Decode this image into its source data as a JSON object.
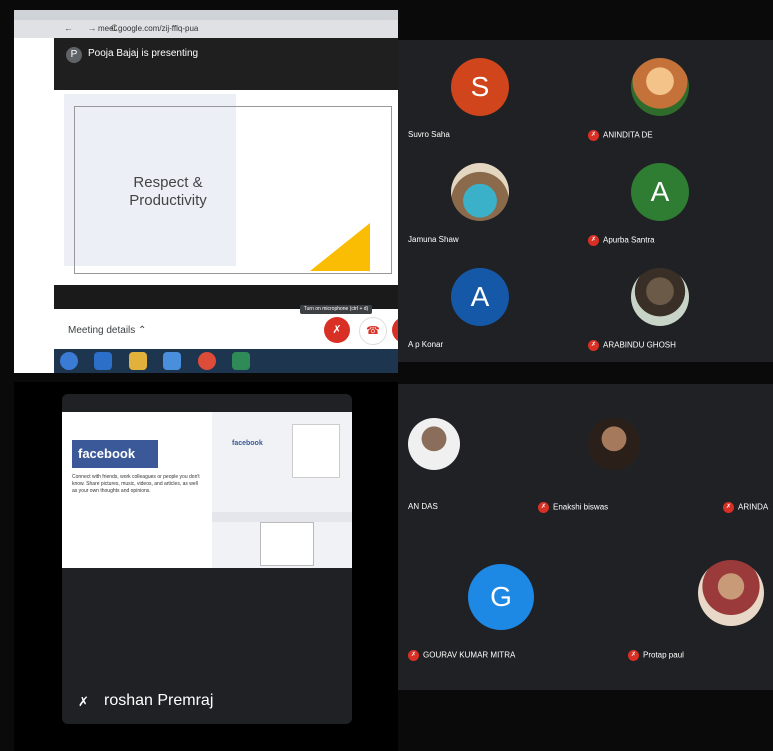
{
  "presentation": {
    "url": "meet.google.com/zij-fflq-pua",
    "presenter_initial": "P",
    "presenter_text": "Pooja Bajaj is presenting",
    "slide_title_line1": "Respect &",
    "slide_title_line2": "Productivity",
    "meeting_details": "Meeting details",
    "turn_on_mic_tooltip": "Turn on microphone (ctrl + d)"
  },
  "grid_top": {
    "participants": [
      {
        "name": "Suvro Saha",
        "initial": "S",
        "color": "#d0451b"
      },
      {
        "name": "ANINDITA DE",
        "initial": "",
        "photo_color": "#c5713a"
      },
      {
        "name": "Jamuna Shaw",
        "initial": "",
        "photo_color": "#3bb0c9"
      },
      {
        "name": "Apurba Santra",
        "initial": "A",
        "color": "#2e7d32"
      },
      {
        "name": "A p Konar",
        "initial": "A",
        "color": "#1558a7"
      },
      {
        "name": "ARABINDU GHOSH",
        "initial": "",
        "photo_color": "#6b5a48"
      }
    ]
  },
  "screen_share": {
    "brand": "facebook",
    "tagline": "Connect with friends, work colleagues or people you don't know. Share pictures, music, videos, and articles, as well as your own thoughts and opinions.",
    "participant_name": "roshan Premraj"
  },
  "grid_bottom": {
    "participants": [
      {
        "name": "AN DAS",
        "initial": "",
        "photo_color": "#8a6d5a"
      },
      {
        "name": "Enakshi biswas",
        "initial": "",
        "photo_color": "#4a3a30"
      },
      {
        "name": "ARINDA",
        "initial": "",
        "photo_color": ""
      },
      {
        "name": "GOURAV KUMAR MITRA",
        "initial": "G",
        "color": "#1e88e5"
      },
      {
        "name": "Protap paul",
        "initial": "",
        "photo_color": "#9a3a3a"
      }
    ]
  },
  "colors": {
    "red": "#d93025",
    "meet_dark": "#202124"
  },
  "icons": [
    "mic-off-icon",
    "hang-up-icon",
    "camera-off-icon",
    "check-icon",
    "chevron-up-icon"
  ]
}
